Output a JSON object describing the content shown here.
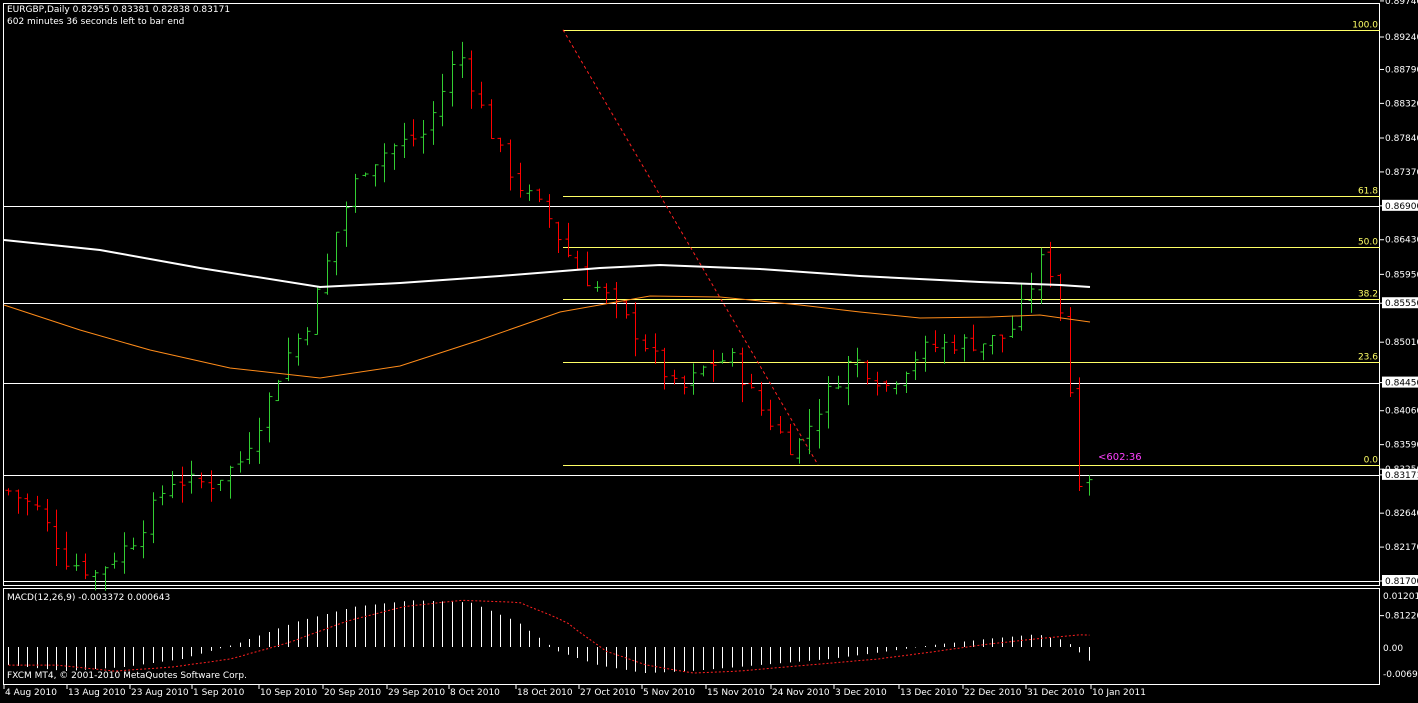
{
  "header": {
    "symbol_line": "EURGBP,Daily  0.82955 0.83381 0.82838 0.83171",
    "countdown_line": "602 minutes 36 seconds left to bar end"
  },
  "watermark": "FXCM MT4, © 2001-2010 MetaQuotes Software Corp.",
  "countdown_label": "<602:36",
  "macd": {
    "label": "MACD(12,26,9) -0.003372 0.000643",
    "axis": [
      "0.01201",
      "0.00",
      "-0.00698"
    ]
  },
  "colors": {
    "background": "#000000",
    "bull_candle": "#32cd32",
    "bear_candle": "#ff0000",
    "fib_line": "#ffff66",
    "fib_trend": "#ff2020",
    "ma_long": "#ffffff",
    "ma_short": "#ff8c1a",
    "hline": "#ffffff",
    "countdown": "#ff40ff",
    "macd_histogram": "#ffffff",
    "macd_signal": "#ff2020"
  },
  "chart_data": {
    "type": "candlestick",
    "symbol": "EURGBP",
    "timeframe": "Daily",
    "ylim": [
      0.8117,
      0.8974
    ],
    "y_ticks": [
      "0.89740",
      "0.89240",
      "0.88790",
      "0.88320",
      "0.87840",
      "0.87370",
      "0.86900",
      "0.86430",
      "0.85950",
      "0.85550",
      "0.85010",
      "0.84450",
      "0.84060",
      "0.83590",
      "0.83250",
      "0.83171",
      "0.82640",
      "0.82170",
      "0.81700",
      "0.81220"
    ],
    "x_ticks": [
      "4 Aug 2010",
      "13 Aug 2010",
      "23 Aug 2010",
      "1 Sep 2010",
      "10 Sep 2010",
      "20 Sep 2010",
      "29 Sep 2010",
      "8 Oct 2010",
      "18 Oct 2010",
      "27 Oct 2010",
      "5 Nov 2010",
      "15 Nov 2010",
      "24 Nov 2010",
      "3 Dec 2010",
      "13 Dec 2010",
      "22 Dec 2010",
      "31 Dec 2010",
      "10 Jan 2011"
    ],
    "fibonacci": {
      "levels": [
        "100.0",
        "61.8",
        "50.0",
        "38.2",
        "23.6",
        "0.0"
      ],
      "high": 0.8934,
      "low": 0.8331
    },
    "horizontal_lines": [
      0.869,
      0.8555,
      0.8445,
      0.8317,
      0.817
    ],
    "grid": false
  }
}
